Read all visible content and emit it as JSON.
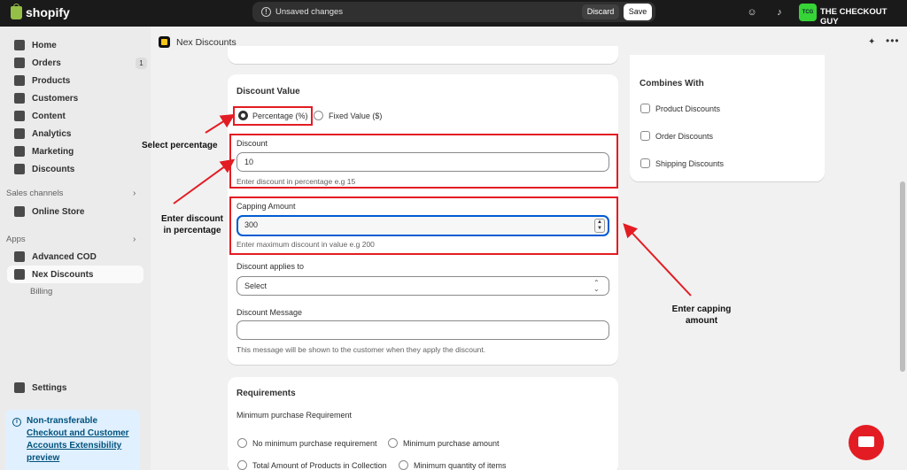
{
  "topbar": {
    "logo_text": "shopify",
    "unsaved_text": "Unsaved changes",
    "discard_label": "Discard",
    "save_label": "Save",
    "store_initials": "TCG",
    "store_name": "THE CHECKOUT GUY"
  },
  "sidebar": {
    "items": [
      {
        "label": "Home"
      },
      {
        "label": "Orders",
        "badge": "1"
      },
      {
        "label": "Products"
      },
      {
        "label": "Customers"
      },
      {
        "label": "Content"
      },
      {
        "label": "Analytics"
      },
      {
        "label": "Marketing"
      },
      {
        "label": "Discounts"
      }
    ],
    "sales_channels_label": "Sales channels",
    "online_store_label": "Online Store",
    "apps_label": "Apps",
    "apps": [
      {
        "label": "Advanced COD"
      },
      {
        "label": "Nex Discounts"
      }
    ],
    "billing_label": "Billing",
    "settings_label": "Settings",
    "notice": {
      "line1": "Non-transferable",
      "link": "Checkout and Customer Accounts Extensibility preview"
    }
  },
  "app_header": {
    "title": "Nex Discounts"
  },
  "discount_value": {
    "title": "Discount Value",
    "option_percentage": "Percentage (%)",
    "option_fixed": "Fixed Value ($)",
    "selected": "percentage",
    "discount_label": "Discount",
    "discount_value": "10",
    "discount_help": "Enter discount in percentage e.g 15",
    "capping_label": "Capping Amount",
    "capping_value": "300",
    "capping_help": "Enter maximum discount in value e.g 200",
    "applies_label": "Discount applies to",
    "applies_value": "Select",
    "message_label": "Discount Message",
    "message_value": "",
    "message_help": "This message will be shown to the customer when they apply the discount."
  },
  "requirements": {
    "title": "Requirements",
    "subtitle": "Minimum purchase Requirement",
    "options": [
      "No minimum purchase requirement",
      "Minimum purchase amount",
      "Total Amount of Products in Collection",
      "Minimum quantity of items"
    ]
  },
  "combines": {
    "title": "Combines With",
    "options": [
      "Product Discounts",
      "Order Discounts",
      "Shipping Discounts"
    ]
  },
  "annotations": {
    "select_percentage": "Select percentage",
    "enter_discount_1": "Enter discount",
    "enter_discount_2": "in percentage",
    "enter_capping_1": "Enter capping",
    "enter_capping_2": "amount"
  },
  "colors": {
    "annotation_red": "#e31c23",
    "focus_blue": "#005bd3",
    "store_badge_green": "#36d436",
    "notice_bg": "#e0f0ff"
  }
}
